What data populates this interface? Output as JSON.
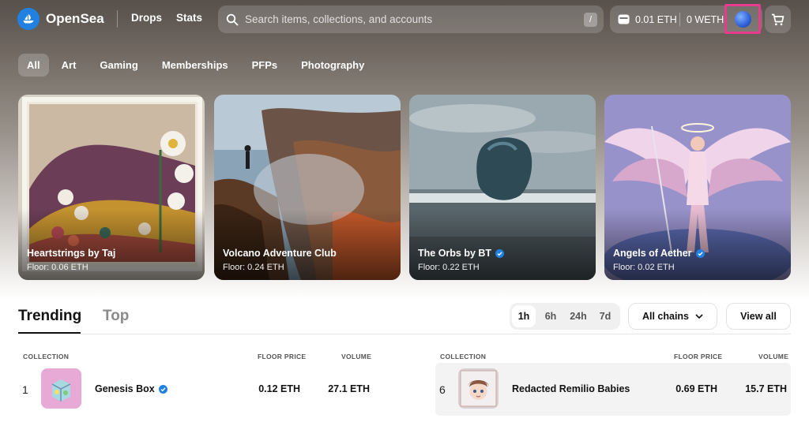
{
  "header": {
    "brand": "OpenSea",
    "nav": [
      "Drops",
      "Stats"
    ],
    "search_placeholder": "Search items, collections, and accounts",
    "search_shortcut": "/",
    "wallet_eth": "0.01 ETH",
    "wallet_weth": "0 WETH"
  },
  "categories": [
    {
      "label": "All",
      "active": true
    },
    {
      "label": "Art",
      "active": false
    },
    {
      "label": "Gaming",
      "active": false
    },
    {
      "label": "Memberships",
      "active": false
    },
    {
      "label": "PFPs",
      "active": false
    },
    {
      "label": "Photography",
      "active": false
    }
  ],
  "featured": [
    {
      "title": "Heartstrings by Taj",
      "floor": "Floor: 0.06 ETH",
      "verified": false
    },
    {
      "title": "Volcano Adventure Club",
      "floor": "Floor: 0.24 ETH",
      "verified": false
    },
    {
      "title": "The Orbs by BT",
      "floor": "Floor: 0.22 ETH",
      "verified": true
    },
    {
      "title": "Angels of Aether",
      "floor": "Floor: 0.02 ETH",
      "verified": true
    }
  ],
  "ranking": {
    "tabs": [
      "Trending",
      "Top"
    ],
    "time_filters": [
      "1h",
      "6h",
      "24h",
      "7d"
    ],
    "active_time": "1h",
    "chains": "All chains",
    "view_all": "View all",
    "columns": {
      "collection": "COLLECTION",
      "floor": "FLOOR PRICE",
      "volume": "VOLUME"
    },
    "rows": [
      {
        "rank": "1",
        "name": "Genesis Box",
        "verified": true,
        "floor": "0.12 ETH",
        "volume": "27.1 ETH"
      },
      {
        "rank": "6",
        "name": "Redacted Remilio Babies",
        "verified": false,
        "floor": "0.69 ETH",
        "volume": "15.7 ETH"
      }
    ]
  },
  "colors": {
    "accent": "#2081e2",
    "highlight": "#e63b8f"
  }
}
